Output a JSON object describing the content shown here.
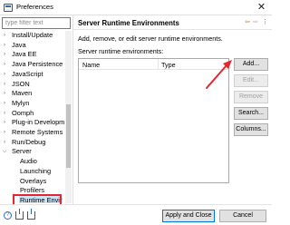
{
  "window": {
    "title": "Preferences",
    "close_glyph": "✕"
  },
  "filter": {
    "value": "",
    "placeholder": "type filter text"
  },
  "tree": {
    "items": [
      {
        "label": "Install/Update",
        "level": 0,
        "expanded": false
      },
      {
        "label": "Java",
        "level": 0,
        "expanded": false
      },
      {
        "label": "Java EE",
        "level": 0,
        "expanded": false
      },
      {
        "label": "Java Persistence",
        "level": 0,
        "expanded": false
      },
      {
        "label": "JavaScript",
        "level": 0,
        "expanded": false
      },
      {
        "label": "JSON",
        "level": 0,
        "expanded": false
      },
      {
        "label": "Maven",
        "level": 0,
        "expanded": false
      },
      {
        "label": "Mylyn",
        "level": 0,
        "expanded": false
      },
      {
        "label": "Oomph",
        "level": 0,
        "expanded": false
      },
      {
        "label": "Plug-in Developm",
        "level": 0,
        "expanded": false
      },
      {
        "label": "Remote Systems",
        "level": 0,
        "expanded": false
      },
      {
        "label": "Run/Debug",
        "level": 0,
        "expanded": false
      },
      {
        "label": "Server",
        "level": 0,
        "expanded": true
      },
      {
        "label": "Audio",
        "level": 1
      },
      {
        "label": "Launching",
        "level": 1
      },
      {
        "label": "Overlays",
        "level": 1
      },
      {
        "label": "Profilers",
        "level": 1
      },
      {
        "label": "Runtime Envir",
        "level": 1,
        "selected": true
      }
    ]
  },
  "page": {
    "title": "Server Runtime Environments",
    "description": "Add, remove, or edit server runtime environments.",
    "list_label": "Server runtime environments:",
    "columns": [
      "Name",
      "Type"
    ],
    "rows": []
  },
  "buttons": {
    "add": "Add...",
    "edit": "Edit...",
    "remove": "Remove",
    "search": "Search...",
    "columns": "Columns..."
  },
  "bottom": {
    "apply_close": "Apply and Close",
    "cancel": "Cancel",
    "help_glyph": "?"
  },
  "icons": {
    "back": "back-arrow-icon",
    "forward": "forward-arrow-icon",
    "menu": "view-menu-icon",
    "help": "help-icon",
    "import": "import-icon",
    "export": "export-icon"
  },
  "colors": {
    "annotation_red": "#e3262f",
    "selection_bg": "#cce4f7",
    "default_button_border": "#0078d7"
  }
}
